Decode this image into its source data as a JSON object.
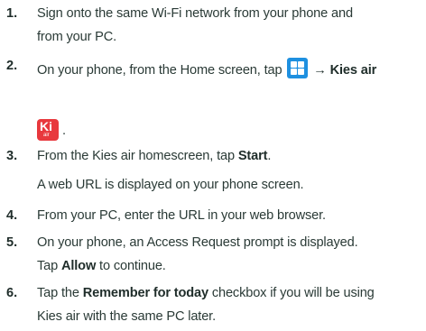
{
  "steps": [
    {
      "num": "1.",
      "lines": [
        "Sign onto the same Wi-Fi network from your phone and",
        "from your PC."
      ]
    },
    {
      "num": "2.",
      "prefix": "On your phone, from the Home screen, tap",
      "arrow": "→",
      "bold": "Kies air",
      "suffix": "."
    },
    {
      "num": "3.",
      "prefix": "From the Kies air homescreen, tap ",
      "bold": "Start",
      "suffix": "."
    },
    {
      "note": "A web URL is displayed on your phone screen."
    },
    {
      "num": "4.",
      "lines": [
        "From your PC, enter the URL in your web browser."
      ]
    },
    {
      "num": "5.",
      "lines": [
        "On your phone, an Access Request prompt is displayed."
      ],
      "prefix": "Tap ",
      "bold": "Allow",
      "suffix": " to continue."
    },
    {
      "num": "6.",
      "prefix": "Tap the ",
      "bold": "Remember for today",
      "suffix": " checkbox if you will be using",
      "lines": [
        "Kies air with the same PC later."
      ]
    }
  ],
  "icons": {
    "apps_icon": "apps-grid-icon",
    "kies_icon": {
      "name": "kies-air-icon",
      "letters": "Ki",
      "sub": "air",
      "color": "#e8383d"
    },
    "apps_color": "#1e90e0"
  }
}
